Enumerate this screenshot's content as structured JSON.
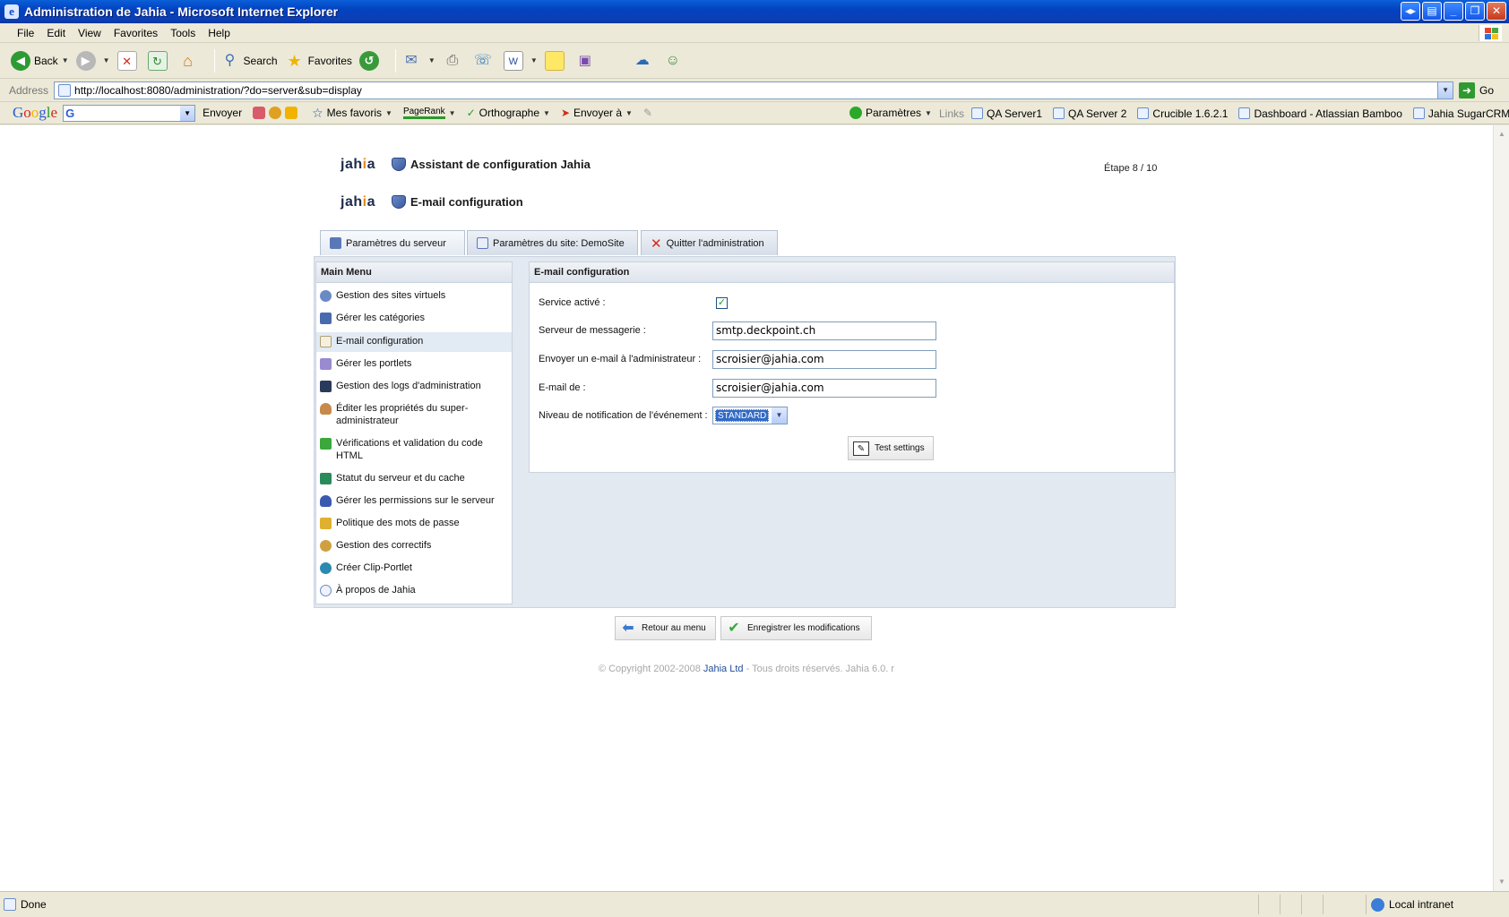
{
  "window": {
    "title": "Administration de Jahia - Microsoft Internet Explorer"
  },
  "menubar": {
    "items": [
      "File",
      "Edit",
      "View",
      "Favorites",
      "Tools",
      "Help"
    ]
  },
  "toolbar": {
    "back": "Back",
    "search": "Search",
    "favorites": "Favorites"
  },
  "address": {
    "label": "Address",
    "url": "http://localhost:8080/administration/?do=server&sub=display",
    "go": "Go"
  },
  "google_toolbar": {
    "logo": "Google",
    "envoyer": "Envoyer",
    "mes_favoris": "Mes favoris",
    "pagerank": "PageRank",
    "orthographe": "Orthographe",
    "envoyer_a": "Envoyer à",
    "parametres": "Paramètres",
    "links_label": "Links",
    "links": [
      "QA Server1",
      "QA Server 2",
      "Crucible 1.6.2.1",
      "Dashboard - Atlassian Bamboo",
      "Jahia SugarCRM"
    ]
  },
  "header": {
    "logo": "jahia",
    "title1": "Assistant de configuration Jahia",
    "title2": "E-mail configuration",
    "step": "Étape 8 / 10"
  },
  "tabs": [
    {
      "label": "Paramètres du serveur"
    },
    {
      "label": "Paramètres du site: DemoSite"
    },
    {
      "label": "Quitter l'administration"
    }
  ],
  "main_menu": {
    "title": "Main Menu",
    "items": [
      {
        "label": "Gestion des sites virtuels"
      },
      {
        "label": "Gérer les catégories"
      },
      {
        "label": "E-mail configuration"
      },
      {
        "label": "Gérer les portlets"
      },
      {
        "label": "Gestion des logs d'administration"
      },
      {
        "label": "Éditer les propriétés du super-administrateur"
      },
      {
        "label": "Vérifications et validation du code HTML"
      },
      {
        "label": "Statut du serveur et du cache"
      },
      {
        "label": "Gérer les permissions sur le serveur"
      },
      {
        "label": "Politique des mots de passe"
      },
      {
        "label": "Gestion des correctifs"
      },
      {
        "label": "Créer Clip-Portlet"
      },
      {
        "label": "À propos de Jahia"
      }
    ]
  },
  "form": {
    "title": "E-mail configuration",
    "service_label": "Service activé :",
    "service_checked": "✓",
    "server_label": "Serveur de messagerie :",
    "server_value": "smtp.deckpoint.ch",
    "admin_label": "Envoyer un e-mail à l'administrateur :",
    "admin_value": "scroisier@jahia.com",
    "from_label": "E-mail de :",
    "from_value": "scroisier@jahia.com",
    "level_label": "Niveau de notification de l'événement :",
    "level_value": "STANDARD",
    "test_button": "Test settings"
  },
  "actions": {
    "back": "Retour au menu",
    "save": "Enregistrer les modifications"
  },
  "footer": {
    "copyright_pre": "© Copyright 2002-2008 ",
    "company": "Jahia Ltd",
    "copyright_post": " - Tous droits réservés. Jahia 6.0. r"
  },
  "status": {
    "text": "Done",
    "zone": "Local intranet"
  }
}
